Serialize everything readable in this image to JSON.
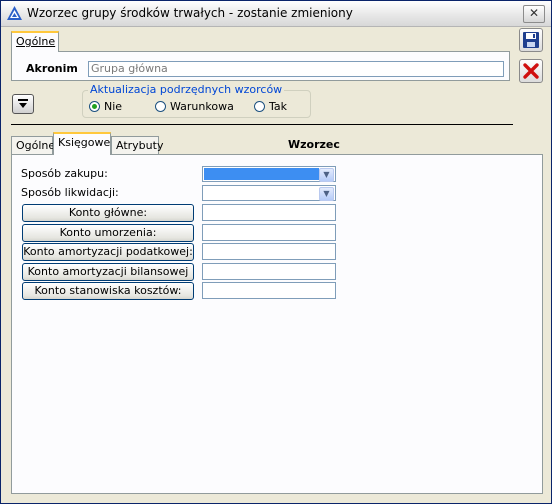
{
  "window": {
    "title": "Wzorzec grupy środków trwałych - zostanie zmieniony",
    "close_label": "✕"
  },
  "top_tabs": {
    "general": "Ogólne"
  },
  "akronim": {
    "label": "Akronim",
    "value": "Grupa główna"
  },
  "update_group": {
    "title": "Aktualizacja podrzędnych wzorców",
    "options": [
      "Nie",
      "Warunkowa",
      "Tak"
    ],
    "selected": "Nie"
  },
  "bottom_tabs": {
    "general": "Ogólne",
    "accounting": "Księgowe",
    "attributes": "Atrybuty",
    "section_title": "Wzorzec"
  },
  "accounting": {
    "purchase_label": "Sposób zakupu:",
    "purchase_value": "",
    "liquidation_label": "Sposób likwidacji:",
    "liquidation_value": "",
    "buttons": [
      "Konto główne:",
      "Konto umorzenia:",
      "Konto amortyzacji podatkowej:",
      "Konto amortyzacji bilansowej",
      "Konto stanowiska kosztów:"
    ],
    "fields": [
      "",
      "",
      "",
      "",
      ""
    ]
  },
  "colors": {
    "selection": "#3d8ef2",
    "tab_highlight": "#ffc83c",
    "group_title": "#0046d5"
  },
  "icons": {
    "save": "floppy-disk-icon",
    "cancel": "red-x-icon",
    "expand": "arrow-down-icon",
    "app": "triangle-logo-icon"
  }
}
